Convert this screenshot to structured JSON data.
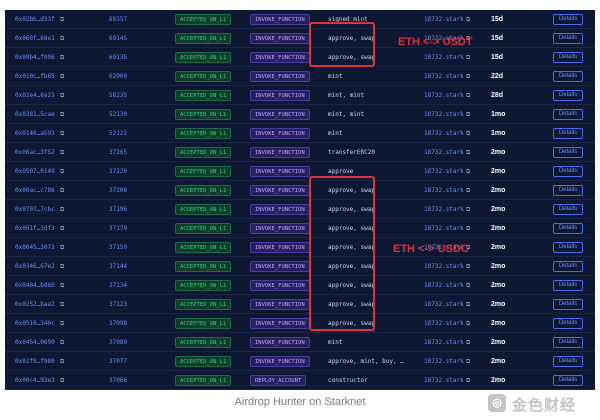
{
  "transactions": [
    {
      "hash": "0x02bb…d33f",
      "block": "69157",
      "status": "ACCEPTED_ON_L1",
      "type": "INVOKE_FUNCTION",
      "calls": "signed_mint",
      "sender": "18732.stark",
      "age": "15d",
      "action": "Details"
    },
    {
      "hash": "0x060f…68e1",
      "block": "69145",
      "status": "ACCEPTED_ON_L1",
      "type": "INVOKE_FUNCTION",
      "calls": "approve, swap",
      "sender": "18732.stark",
      "age": "15d",
      "action": "Details"
    },
    {
      "hash": "0x00b4…f096",
      "block": "69135",
      "status": "ACCEPTED_ON_L1",
      "type": "INVOKE_FUNCTION",
      "calls": "approve, swap",
      "sender": "18732.stark",
      "age": "15d",
      "action": "Details"
    },
    {
      "hash": "0x010c…fb65",
      "block": "62900",
      "status": "ACCEPTED_ON_L1",
      "type": "INVOKE_FUNCTION",
      "calls": "mint",
      "sender": "18732.stark",
      "age": "22d",
      "action": "Details"
    },
    {
      "hash": "0x02e4…0a23",
      "block": "58235",
      "status": "ACCEPTED_ON_L1",
      "type": "INVOKE_FUNCTION",
      "calls": "mint, mint",
      "sender": "18732.stark",
      "age": "28d",
      "action": "Details"
    },
    {
      "hash": "0x0281…5cae",
      "block": "52130",
      "status": "ACCEPTED_ON_L1",
      "type": "INVOKE_FUNCTION",
      "calls": "mint, mint",
      "sender": "18732.stark",
      "age": "1mo",
      "action": "Details"
    },
    {
      "hash": "0x0140…a593",
      "block": "52122",
      "status": "ACCEPTED_ON_L1",
      "type": "INVOKE_FUNCTION",
      "calls": "mint",
      "sender": "18732.stark",
      "age": "1mo",
      "action": "Details"
    },
    {
      "hash": "0x06ac…3f52",
      "block": "37265",
      "status": "ACCEPTED_ON_L1",
      "type": "INVOKE_FUNCTION",
      "calls": "transferERC20",
      "sender": "18732.stark",
      "age": "2mo",
      "action": "Details"
    },
    {
      "hash": "0x0507…0149",
      "block": "37220",
      "status": "ACCEPTED_ON_L1",
      "type": "INVOKE_FUNCTION",
      "calls": "approve",
      "sender": "18732.stark",
      "age": "2mo",
      "action": "Details"
    },
    {
      "hash": "0x00ac…c786",
      "block": "37206",
      "status": "ACCEPTED_ON_L1",
      "type": "INVOKE_FUNCTION",
      "calls": "approve, swap",
      "sender": "18732.stark",
      "age": "2mo",
      "action": "Details"
    },
    {
      "hash": "0x0707…7cbc",
      "block": "37196",
      "status": "ACCEPTED_ON_L1",
      "type": "INVOKE_FUNCTION",
      "calls": "approve, swap",
      "sender": "18732.stark",
      "age": "2mo",
      "action": "Details"
    },
    {
      "hash": "0x061f…2df3",
      "block": "37179",
      "status": "ACCEPTED_ON_L1",
      "type": "INVOKE_FUNCTION",
      "calls": "approve, swap",
      "sender": "18732.stark",
      "age": "2mo",
      "action": "Details"
    },
    {
      "hash": "0x0045…3073",
      "block": "37159",
      "status": "ACCEPTED_ON_L1",
      "type": "INVOKE_FUNCTION",
      "calls": "approve, swap",
      "sender": "18732.stark",
      "age": "2mo",
      "action": "Details"
    },
    {
      "hash": "0x0346…67e2",
      "block": "37144",
      "status": "ACCEPTED_ON_L1",
      "type": "INVOKE_FUNCTION",
      "calls": "approve, swap",
      "sender": "18732.stark",
      "age": "2mo",
      "action": "Details"
    },
    {
      "hash": "0x0484…bd6b",
      "block": "37134",
      "status": "ACCEPTED_ON_L1",
      "type": "INVOKE_FUNCTION",
      "calls": "approve, swap",
      "sender": "18732.stark",
      "age": "2mo",
      "action": "Details"
    },
    {
      "hash": "0x0252…baa2",
      "block": "37123",
      "status": "ACCEPTED_ON_L1",
      "type": "INVOKE_FUNCTION",
      "calls": "approve, swap",
      "sender": "18732.stark",
      "age": "2mo",
      "action": "Details"
    },
    {
      "hash": "0x0510…340c",
      "block": "37098",
      "status": "ACCEPTED_ON_L1",
      "type": "INVOKE_FUNCTION",
      "calls": "approve, swap",
      "sender": "18732.stark",
      "age": "2mo",
      "action": "Details"
    },
    {
      "hash": "0x0454…0690",
      "block": "37089",
      "status": "ACCEPTED_ON_L1",
      "type": "INVOKE_FUNCTION",
      "calls": "mint",
      "sender": "18732.stark",
      "age": "2mo",
      "action": "Details"
    },
    {
      "hash": "0x02f9…f980",
      "block": "37077",
      "status": "ACCEPTED_ON_L1",
      "type": "INVOKE_FUNCTION",
      "calls": "approve, mint, buy, …",
      "sender": "18732.stark",
      "age": "2mo",
      "action": "Details"
    },
    {
      "hash": "0x00c4…93e3",
      "block": "37066",
      "status": "ACCEPTED_ON_L1",
      "type": "DEPLOY_ACCOUNT",
      "calls": "constructor",
      "sender": "18732.stark",
      "age": "2mo",
      "action": "Details"
    }
  ],
  "annotations": {
    "eth_usdt": "ETH <-> USDT",
    "eth_usdc": "ETH <-> USDC",
    "highlight_color": "#e0323c"
  },
  "caption": "Airdrop Hunter on Starknet",
  "watermark": {
    "text": "金色财经",
    "icon": "coin-logo-icon"
  },
  "colors": {
    "background": "#0f1833",
    "link": "#6d8ef6",
    "status": "#34d67d",
    "type_badge": "#b3a8ff"
  }
}
